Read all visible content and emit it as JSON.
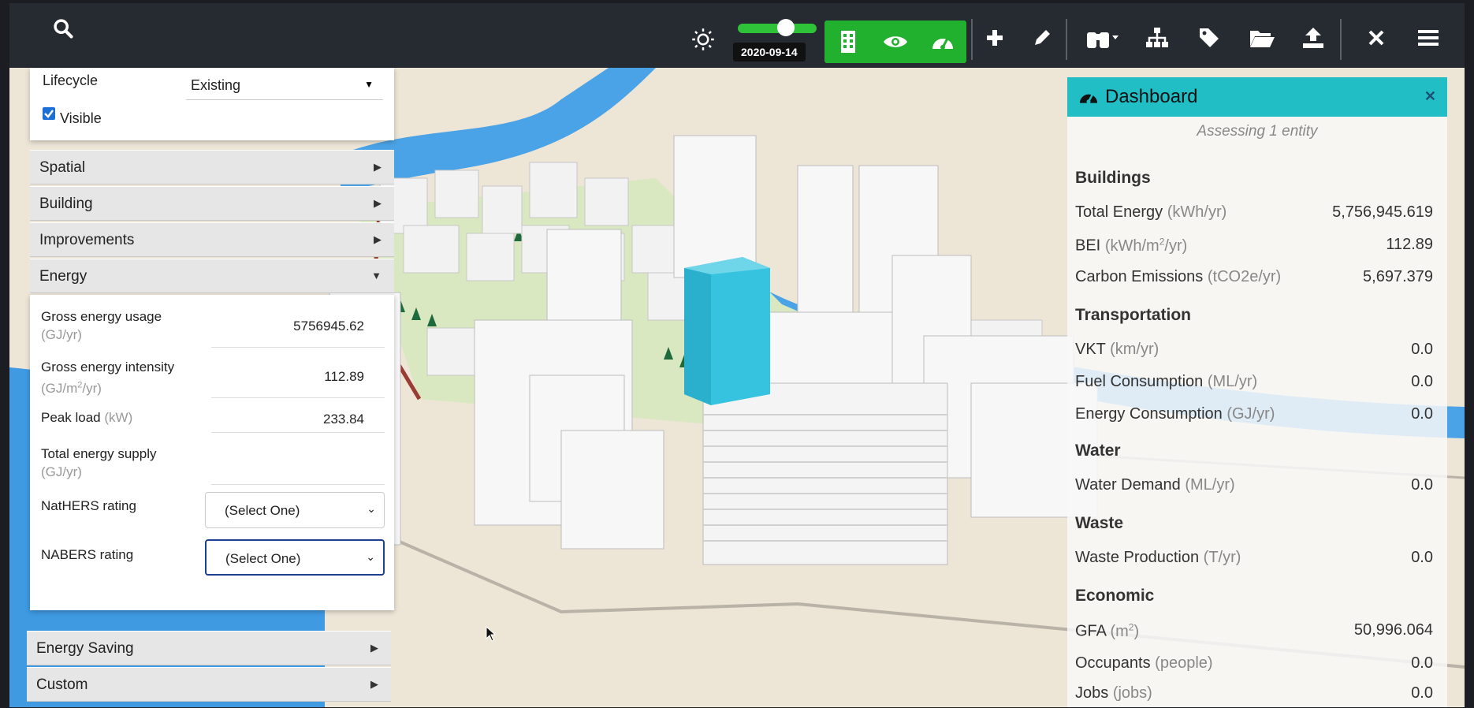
{
  "toolbar": {
    "date": "2020-09-14",
    "timeline_value": 0.5
  },
  "left_panel": {
    "lifecycle_label": "Lifecycle",
    "lifecycle_value": "Existing",
    "visible_label": "Visible",
    "sections": {
      "spatial": "Spatial",
      "building": "Building",
      "improvements": "Improvements",
      "energy": "Energy",
      "energy_saving": "Energy Saving",
      "custom": "Custom"
    },
    "energy_fields": {
      "gross_usage_label": "Gross energy usage",
      "gross_usage_unit": "(GJ/yr)",
      "gross_usage_value": "5756945.62",
      "intensity_label": "Gross energy intensity",
      "intensity_unit_a": "(GJ/m",
      "intensity_unit_sup": "2",
      "intensity_unit_b": "/yr)",
      "intensity_value": "112.89",
      "peak_label": "Peak load",
      "peak_unit": "(kW)",
      "peak_value": "233.84",
      "supply_label": "Total energy supply",
      "supply_unit": "(GJ/yr)",
      "nathers_label": "NatHERS rating",
      "nathers_value": "(Select One)",
      "nabers_label": "NABERS rating",
      "nabers_value": "(Select One)"
    }
  },
  "dashboard": {
    "title": "Dashboard",
    "subtitle": "Assessing 1 entity",
    "buildings": {
      "heading": "Buildings",
      "total_energy_label": "Total Energy",
      "total_energy_unit": "(kWh/yr)",
      "total_energy_value": "5,756,945.619",
      "bei_label": "BEI",
      "bei_unit_a": "(kWh/m",
      "bei_unit_sup": "2",
      "bei_unit_b": "/yr)",
      "bei_value": "112.89",
      "carbon_label": "Carbon Emissions",
      "carbon_unit": "(tCO2e/yr)",
      "carbon_value": "5,697.379"
    },
    "transportation": {
      "heading": "Transportation",
      "vkt_label": "VKT",
      "vkt_unit": "(km/yr)",
      "vkt_value": "0.0",
      "fuel_label": "Fuel Consumption",
      "fuel_unit": "(ML/yr)",
      "fuel_value": "0.0",
      "energy_label": "Energy Consumption",
      "energy_unit": "(GJ/yr)",
      "energy_value": "0.0"
    },
    "water": {
      "heading": "Water",
      "demand_label": "Water Demand",
      "demand_unit": "(ML/yr)",
      "demand_value": "0.0"
    },
    "waste": {
      "heading": "Waste",
      "production_label": "Waste Production",
      "production_unit": "(T/yr)",
      "production_value": "0.0"
    },
    "economic": {
      "heading": "Economic",
      "gfa_label": "GFA",
      "gfa_unit_a": "(m",
      "gfa_unit_sup": "2",
      "gfa_unit_b": ")",
      "gfa_value": "50,996.064",
      "occupants_label": "Occupants",
      "occupants_unit": "(people)",
      "occupants_value": "0.0",
      "jobs_label": "Jobs",
      "jobs_unit": "(jobs)",
      "jobs_value": "0.0"
    }
  },
  "colors": {
    "toolbar_bg": "#262a31",
    "active_green": "#22b12e",
    "dashboard_header": "#22bec6",
    "selected_building": "#36c3e0",
    "river": "#3f9ae2"
  }
}
